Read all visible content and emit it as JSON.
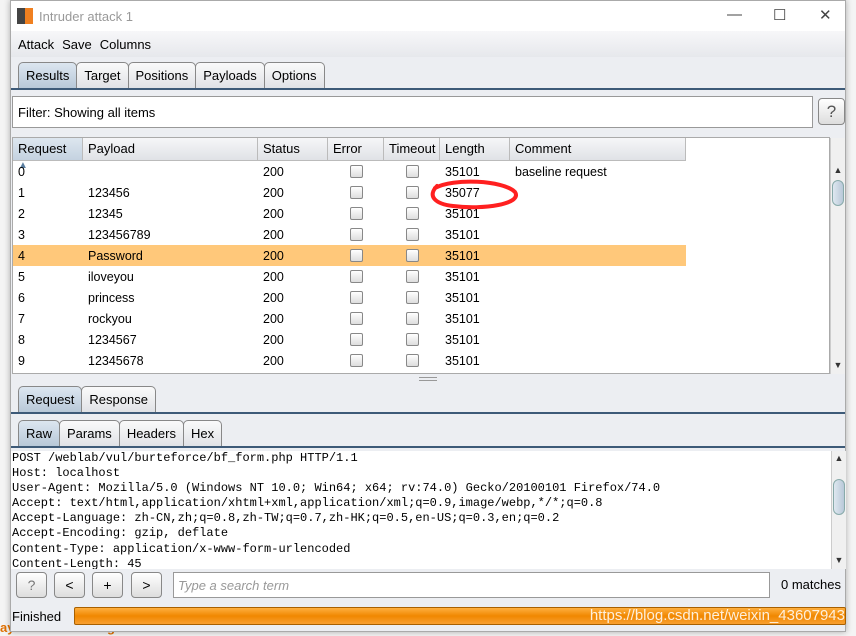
{
  "window": {
    "title": "Intruder attack 1",
    "controls": [
      "—",
      "☐",
      "✕"
    ]
  },
  "background": {
    "bottom_label": "ayload Processing"
  },
  "menu": [
    "Attack",
    "Save",
    "Columns"
  ],
  "main_tabs": [
    {
      "label": "Results",
      "active": true
    },
    {
      "label": "Target"
    },
    {
      "label": "Positions"
    },
    {
      "label": "Payloads"
    },
    {
      "label": "Options"
    }
  ],
  "filter": {
    "text": "Filter: Showing all items",
    "help": "?"
  },
  "table": {
    "columns": [
      "Request",
      "Payload",
      "Status",
      "Error",
      "Timeout",
      "Length",
      "Comment"
    ],
    "sort_indicator": "▲",
    "rows": [
      {
        "request": "0",
        "payload": "",
        "status": "200",
        "error": false,
        "timeout": false,
        "length": "35101",
        "comment": "baseline request"
      },
      {
        "request": "1",
        "payload": "123456",
        "status": "200",
        "error": false,
        "timeout": false,
        "length": "35077",
        "comment": "",
        "annotated": true
      },
      {
        "request": "2",
        "payload": "12345",
        "status": "200",
        "error": false,
        "timeout": false,
        "length": "35101",
        "comment": ""
      },
      {
        "request": "3",
        "payload": "123456789",
        "status": "200",
        "error": false,
        "timeout": false,
        "length": "35101",
        "comment": ""
      },
      {
        "request": "4",
        "payload": "Password",
        "status": "200",
        "error": false,
        "timeout": false,
        "length": "35101",
        "comment": "",
        "selected": true
      },
      {
        "request": "5",
        "payload": "iloveyou",
        "status": "200",
        "error": false,
        "timeout": false,
        "length": "35101",
        "comment": ""
      },
      {
        "request": "6",
        "payload": "princess",
        "status": "200",
        "error": false,
        "timeout": false,
        "length": "35101",
        "comment": ""
      },
      {
        "request": "7",
        "payload": "rockyou",
        "status": "200",
        "error": false,
        "timeout": false,
        "length": "35101",
        "comment": ""
      },
      {
        "request": "8",
        "payload": "1234567",
        "status": "200",
        "error": false,
        "timeout": false,
        "length": "35101",
        "comment": ""
      },
      {
        "request": "9",
        "payload": "12345678",
        "status": "200",
        "error": false,
        "timeout": false,
        "length": "35101",
        "comment": ""
      }
    ]
  },
  "annotation_color": "#ff2020",
  "reqres_tabs": [
    {
      "label": "Request",
      "active": true
    },
    {
      "label": "Response"
    }
  ],
  "view_tabs": [
    {
      "label": "Raw",
      "active": true
    },
    {
      "label": "Params"
    },
    {
      "label": "Headers"
    },
    {
      "label": "Hex"
    }
  ],
  "request_lines": [
    "POST /weblab/vul/burteforce/bf_form.php HTTP/1.1",
    "Host: localhost",
    "User-Agent: Mozilla/5.0 (Windows NT 10.0; Win64; x64; rv:74.0) Gecko/20100101 Firefox/74.0",
    "Accept: text/html,application/xhtml+xml,application/xml;q=0.9,image/webp,*/*;q=0.8",
    "Accept-Language: zh-CN,zh;q=0.8,zh-TW;q=0.7,zh-HK;q=0.5,en-US;q=0.3,en;q=0.2",
    "Accept-Encoding: gzip, deflate",
    "Content-Type: application/x-www-form-urlencoded",
    "Content-Length: 45"
  ],
  "search": {
    "buttons": [
      "?",
      "<",
      "+",
      ">"
    ],
    "placeholder": "Type a search term",
    "matches": "0 matches"
  },
  "status": {
    "text": "Finished",
    "progress_percent": 100,
    "watermark": "https://blog.csdn.net/weixin_43607943"
  }
}
